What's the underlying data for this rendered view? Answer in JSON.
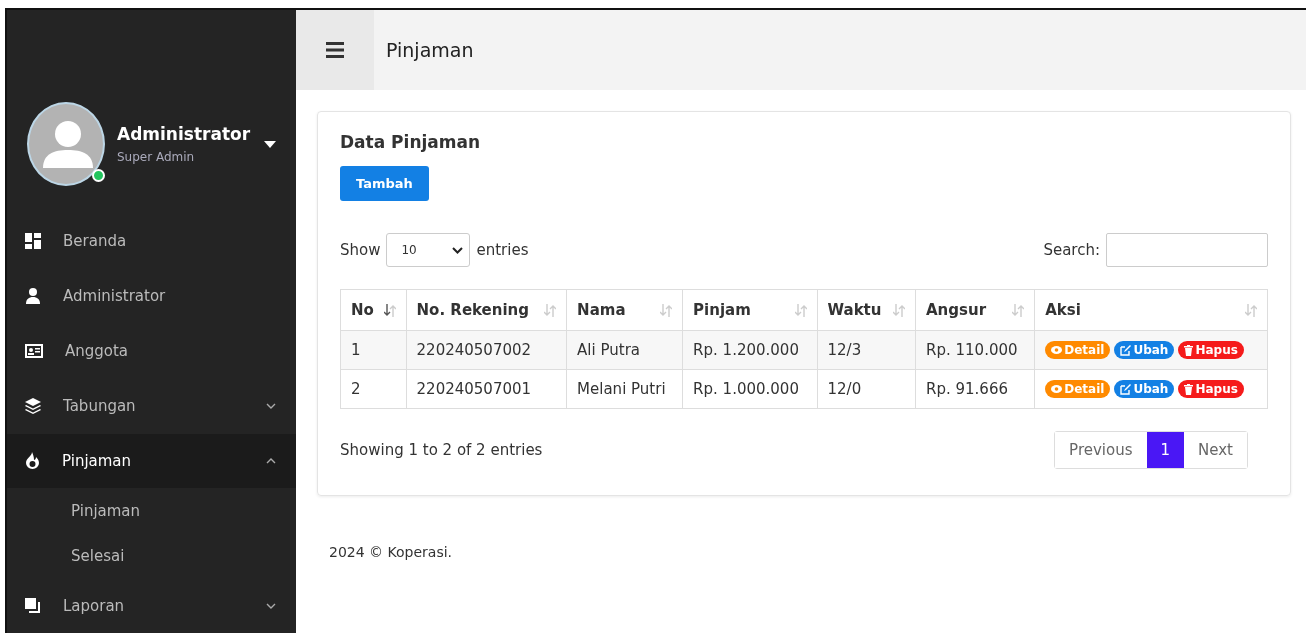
{
  "header": {
    "title": "Pinjaman"
  },
  "user": {
    "name": "Administrator",
    "role": "Super Admin",
    "online": true
  },
  "sidebar": {
    "items": [
      {
        "label": "Beranda",
        "selected": false
      },
      {
        "label": "Administrator",
        "selected": false
      },
      {
        "label": "Anggota",
        "selected": false
      },
      {
        "label": "Tabungan",
        "selected": false,
        "expanded": false
      },
      {
        "label": "Pinjaman",
        "selected": true,
        "expanded": true,
        "children": [
          {
            "label": "Pinjaman"
          },
          {
            "label": "Selesai"
          }
        ]
      },
      {
        "label": "Laporan",
        "selected": false,
        "expanded": false
      }
    ]
  },
  "card": {
    "title": "Data Pinjaman",
    "add_button": "Tambah",
    "length": {
      "before": "Show",
      "value": "10",
      "after": "entries"
    },
    "search": {
      "label": "Search:"
    },
    "table": {
      "columns": [
        {
          "label": "No",
          "sorted": true
        },
        {
          "label": "No. Rekening",
          "sorted": false
        },
        {
          "label": "Nama",
          "sorted": false
        },
        {
          "label": "Pinjam",
          "sorted": false
        },
        {
          "label": "Waktu",
          "sorted": false
        },
        {
          "label": "Angsur",
          "sorted": false
        },
        {
          "label": "Aksi",
          "sorted": false
        }
      ],
      "rows": [
        {
          "cells": [
            "1",
            "220240507002",
            "Ali Putra",
            "Rp. 1.200.000",
            "12/3",
            "Rp. 110.000"
          ],
          "actions": [
            {
              "kind": "view",
              "label": "Detail"
            },
            {
              "kind": "edit",
              "label": "Ubah"
            },
            {
              "kind": "delete",
              "label": "Hapus"
            }
          ]
        },
        {
          "cells": [
            "2",
            "220240507001",
            "Melani Putri",
            "Rp. 1.000.000",
            "12/0",
            "Rp. 91.666"
          ],
          "actions": [
            {
              "kind": "view",
              "label": "Detail"
            },
            {
              "kind": "edit",
              "label": "Ubah"
            },
            {
              "kind": "delete",
              "label": "Hapus"
            }
          ]
        }
      ]
    },
    "info": "Showing 1 to 2 of 2 entries",
    "pagination": [
      {
        "label": "Previous",
        "selected": false
      },
      {
        "label": "1",
        "selected": true
      },
      {
        "label": "Next",
        "selected": false
      }
    ]
  },
  "footer": "2024 © Koperasi."
}
